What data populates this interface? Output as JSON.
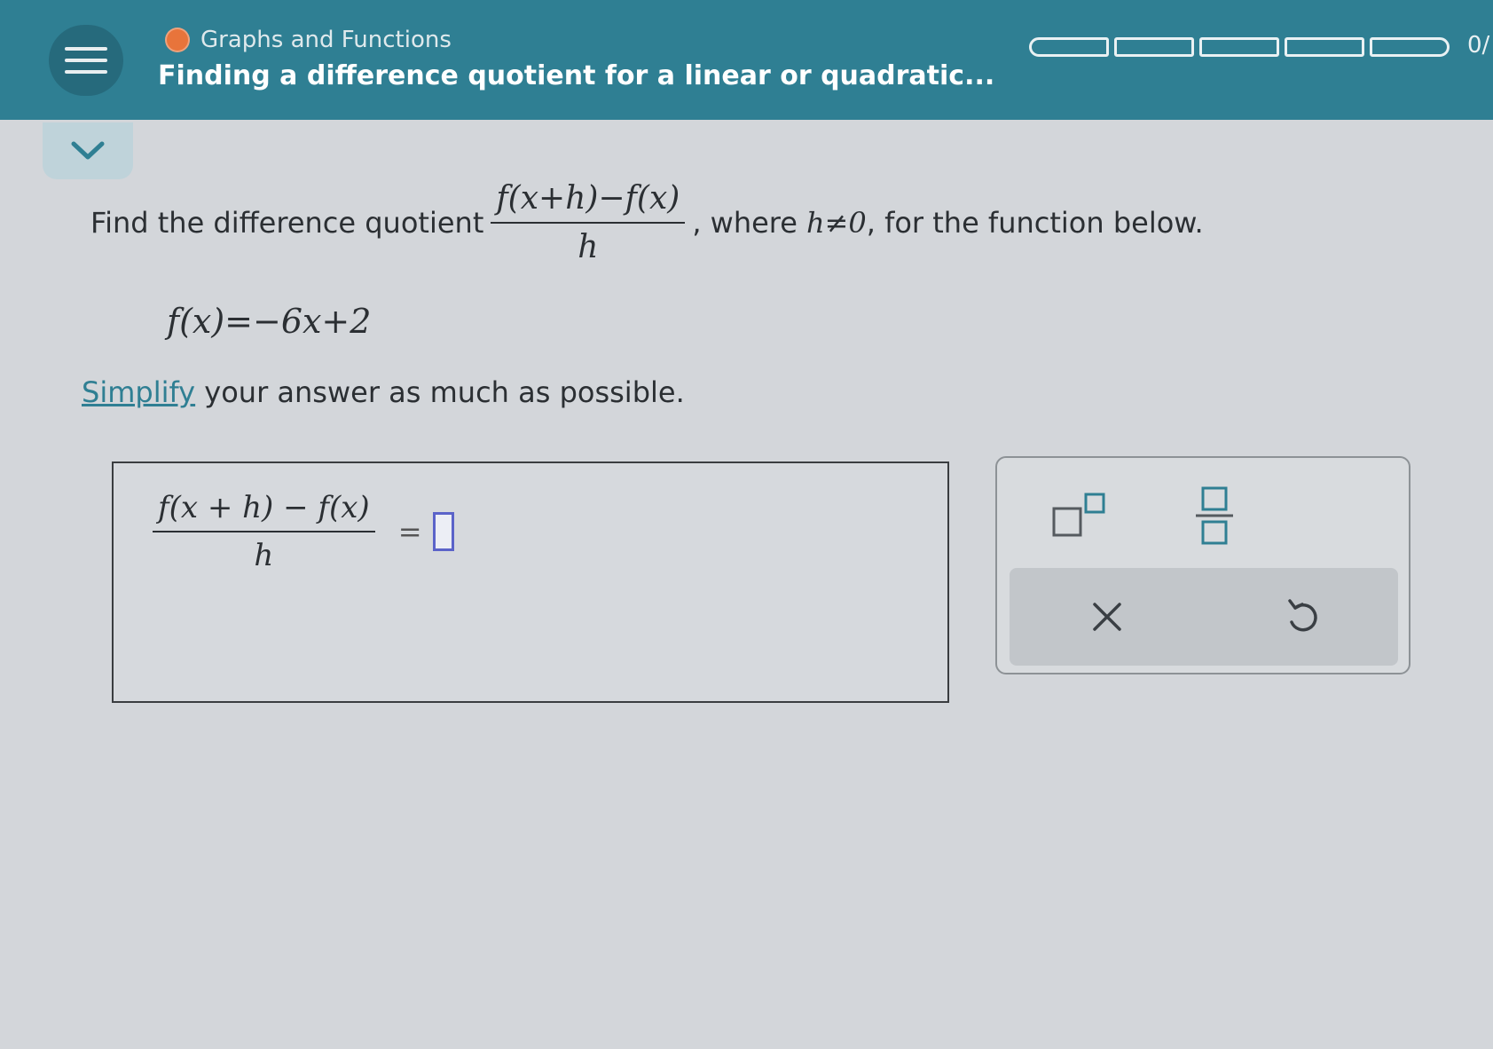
{
  "header": {
    "topic": "Graphs and Functions",
    "lesson_title": "Finding a difference quotient for a linear or quadratic...",
    "progress_count": "0/",
    "progress_segments": 5,
    "accent": "#2f7f93",
    "topic_dot_color": "#e8743b"
  },
  "icons": {
    "menu": "hamburger-menu-icon",
    "collapse": "chevron-down-icon",
    "exponent": "exponent-template-icon",
    "fraction": "fraction-template-icon",
    "clear": "close-icon",
    "undo": "undo-icon"
  },
  "question": {
    "prefix": "Find the difference quotient",
    "quotient_numerator": "f(x+h)−f(x)",
    "quotient_denominator": "h",
    "where_text": ", where",
    "condition": "h≠0",
    "suffix": ", for the function below.",
    "function_definition": "f(x)=−6x+2",
    "simplify_link": "Simplify",
    "instruction_rest": " your answer as much as possible."
  },
  "answer": {
    "numerator": "f(x + h) − f(x)",
    "denominator": "h",
    "equals": "=",
    "value": ""
  },
  "keypad": {
    "clear_symbol": "×"
  }
}
